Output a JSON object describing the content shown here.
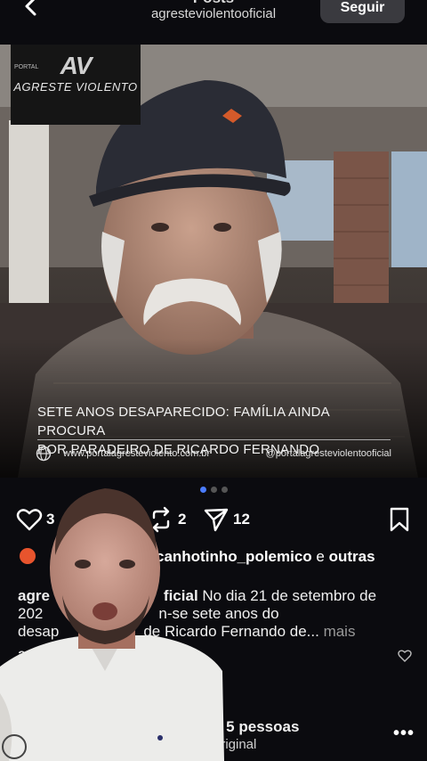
{
  "header": {
    "title": "Posts",
    "username": "agresteviolentooficial",
    "follow_label": "Seguir"
  },
  "media": {
    "logo_short": "AV",
    "logo_tag": "PORTAL",
    "logo_name": "AGRESTE VIOLENTO",
    "caption_line1": "SETE ANOS DESAPARECIDO: FAMÍLIA AINDA PROCURA",
    "caption_line2": "POR PARADEIRO DE RICARDO FERNANDO",
    "site_url": "www.portalagresteviolento.com.br",
    "site_handle": "@portalagresteviolentooficial",
    "carousel_total": 3,
    "carousel_active": 1
  },
  "actions": {
    "likes": "3",
    "reposts": "2",
    "shares": "12",
    "icons": [
      "heart-icon",
      "repost-icon",
      "send-icon",
      "bookmark-icon"
    ]
  },
  "liked_by": {
    "user": "canhotinho_polemico",
    "connector": " e ",
    "others": "outras"
  },
  "post": {
    "user_visible": "agre",
    "user_tail": "ficial",
    "text_line1": " No dia 21 de setembro de",
    "text_line2_start": "202",
    "text_line2_end": "n-se sete anos do",
    "text_line3_start": "desap",
    "text_line3_end": "de Ricardo Fernando de...",
    "more_label": " mais",
    "comment_user": "agr"
  },
  "footer": {
    "others": "s 5 pessoas",
    "audio": "original",
    "menu": "•••"
  },
  "colors": {
    "background": "#0b0b0f",
    "follow_button": "#3a3a3f",
    "dot_active": "#4a7cff",
    "dot_inactive": "#555555"
  }
}
